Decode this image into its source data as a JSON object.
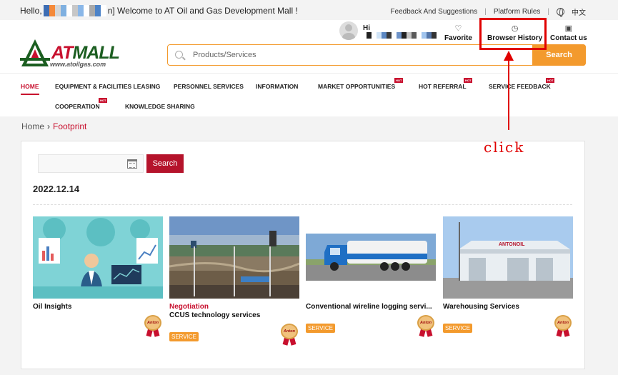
{
  "topbar": {
    "hello_prefix": "Hello,",
    "hello_suffix": "n] Welcome to AT Oil and Gas Development Mall !",
    "links": [
      "Feedback And Suggestions",
      "Platform Rules"
    ],
    "language": "中文"
  },
  "header": {
    "logo_at": "AT",
    "logo_mall": "MALL",
    "logo_url": "www.atoilgas.com",
    "search_placeholder": "Products/Services",
    "search_button": "Search",
    "user_greeting": "Hi",
    "favorite": "Favorite",
    "browser_history": "Browser History",
    "contact_us": "Contact us"
  },
  "nav": {
    "items": [
      {
        "label": "HOME",
        "hot": false
      },
      {
        "label": "EQUIPMENT & FACILITIES LEASING",
        "hot": false
      },
      {
        "label": "PERSONNEL SERVICES",
        "hot": false
      },
      {
        "label": "INFORMATION",
        "hot": false
      },
      {
        "label": "MARKET OPPORTUNITIES",
        "hot": true
      },
      {
        "label": "HOT REFERRAL",
        "hot": true
      },
      {
        "label": "SERVICE FEEDBACK",
        "hot": true
      },
      {
        "label": "COOPERATION",
        "hot": true
      },
      {
        "label": "KNOWLEDGE SHARING",
        "hot": false
      }
    ],
    "hot_label": "HOT"
  },
  "breadcrumb": {
    "home": "Home",
    "current": "Footprint"
  },
  "main": {
    "search_button": "Search",
    "date": "2022.12.14",
    "cards": [
      {
        "status": "",
        "title": "Oil Insights",
        "tag": ""
      },
      {
        "status": "Negotiation",
        "title": "CCUS technology services",
        "tag": "SERVICE"
      },
      {
        "status": "",
        "title": "Conventional wireline logging servi...",
        "tag": "SERVICE"
      },
      {
        "status": "",
        "title": "Warehousing Services",
        "tag": "SERVICE"
      }
    ],
    "medal_text": "Anton",
    "warehouse_sign": "ANTONOIL"
  },
  "annotation": {
    "text": "click"
  },
  "colors": {
    "brand_red": "#c8102e",
    "accent_orange": "#f39a2d",
    "annotation_red": "#e00000"
  }
}
